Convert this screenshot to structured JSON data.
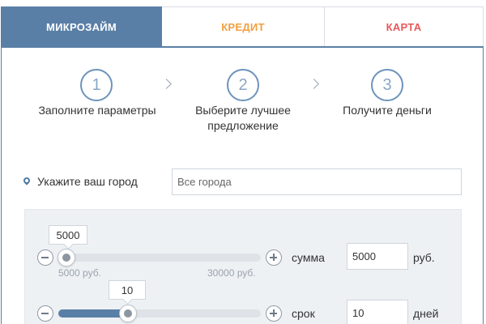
{
  "tabs": [
    {
      "label": "МИКРОЗАЙМ",
      "active": true
    },
    {
      "label": "КРЕДИТ",
      "active": false
    },
    {
      "label": "КАРТА",
      "active": false
    }
  ],
  "steps": [
    {
      "number": "1",
      "line1": "Заполните параметры",
      "line2": ""
    },
    {
      "number": "2",
      "line1": "Выберите лучшее",
      "line2": "предложение"
    },
    {
      "number": "3",
      "line1": "Получите деньги",
      "line2": ""
    }
  ],
  "city": {
    "label": "Укажите ваш город",
    "value": "Все города"
  },
  "amount": {
    "tooltip": "5000",
    "min_label": "5000 руб.",
    "max_label": "30000 руб.",
    "label": "сумма",
    "value": "5000",
    "unit": "руб.",
    "fraction": 0.0
  },
  "term": {
    "tooltip": "10",
    "label": "срок",
    "value": "10",
    "unit": "дней",
    "fraction": 0.33
  },
  "colors": {
    "accent": "#5a7fa6",
    "credit": "#f0a040",
    "card": "#e8595a"
  }
}
